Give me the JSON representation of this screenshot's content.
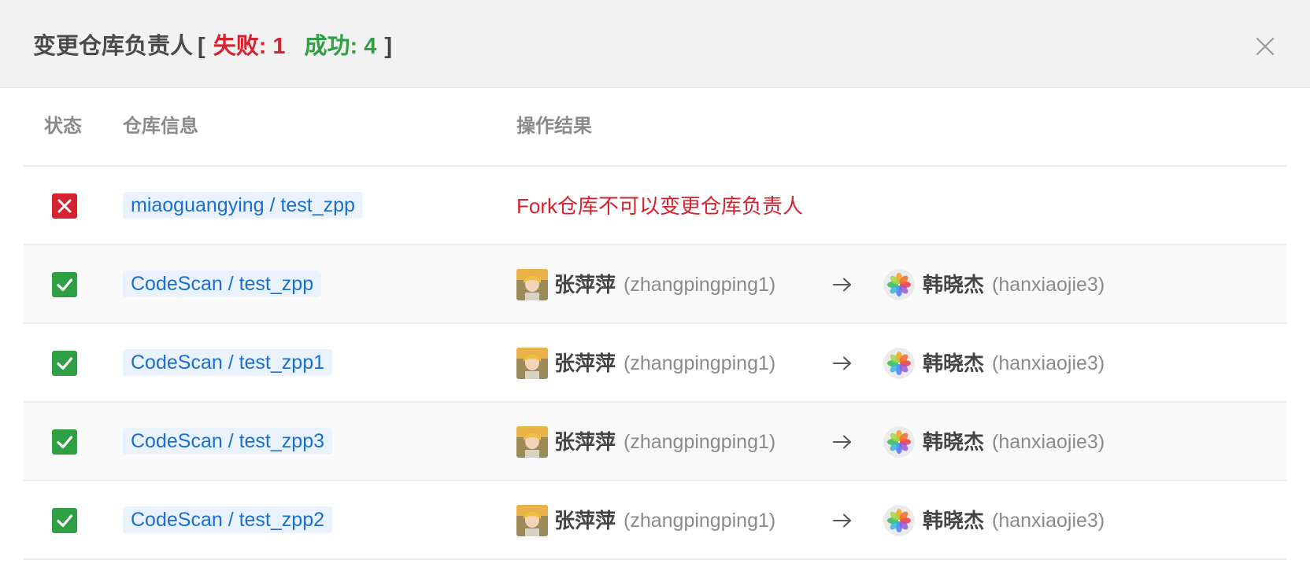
{
  "dialog": {
    "title": "变更仓库负责人",
    "bracket_open": "[",
    "bracket_close": "]",
    "failed_label": "失败: 1",
    "success_label": "成功: 4",
    "close_icon": "close-icon"
  },
  "table": {
    "headers": {
      "status": "状态",
      "repo": "仓库信息",
      "result": "操作结果"
    },
    "rows": [
      {
        "status": "failed",
        "repo": "miaoguangying / test_zpp",
        "message": "Fork仓库不可以变更仓库负责人"
      },
      {
        "status": "success",
        "repo": "CodeScan / test_zpp",
        "from_name": "张萍萍",
        "from_id": "(zhangpingping1)",
        "to_name": "韩晓杰",
        "to_id": "(hanxiaojie3)"
      },
      {
        "status": "success",
        "repo": "CodeScan / test_zpp1",
        "from_name": "张萍萍",
        "from_id": "(zhangpingping1)",
        "to_name": "韩晓杰",
        "to_id": "(hanxiaojie3)"
      },
      {
        "status": "success",
        "repo": "CodeScan / test_zpp3",
        "from_name": "张萍萍",
        "from_id": "(zhangpingping1)",
        "to_name": "韩晓杰",
        "to_id": "(hanxiaojie3)"
      },
      {
        "status": "success",
        "repo": "CodeScan / test_zpp2",
        "from_name": "张萍萍",
        "from_id": "(zhangpingping1)",
        "to_name": "韩晓杰",
        "to_id": "(hanxiaojie3)"
      }
    ]
  },
  "colors": {
    "failed": "#d4232f",
    "success": "#2ea043",
    "link": "#1a6fce",
    "link_bg": "#eaf3fd"
  },
  "icons": {
    "failed_status": "x-mark-icon",
    "success_status": "checkmark-icon",
    "arrow": "right-arrow-icon",
    "from_avatar": "user-avatar-icon",
    "to_avatar": "photos-avatar-icon"
  }
}
